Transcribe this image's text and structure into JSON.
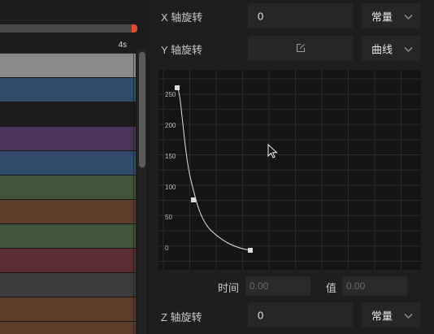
{
  "timeline": {
    "ruler_label": "4s",
    "tracks": [
      {
        "color": "#8a8a8a"
      },
      {
        "color": "#2f4a6a"
      },
      {
        "color": "#1c1c1c"
      },
      {
        "color": "#4a3458"
      },
      {
        "color": "#2f4a6a"
      },
      {
        "color": "#3f5438"
      },
      {
        "color": "#5c3d2c"
      },
      {
        "color": "#3f5438"
      },
      {
        "color": "#5a2e30"
      },
      {
        "color": "#3c3c3c"
      },
      {
        "color": "#5c3d2c"
      },
      {
        "color": "#5c3d2c"
      }
    ]
  },
  "props": {
    "x_rotation": {
      "label": "X 轴旋转",
      "value": "0",
      "mode": "常量"
    },
    "y_rotation": {
      "label": "Y 轴旋转",
      "mode": "曲线",
      "edit_icon": "edit-icon"
    },
    "curve": {
      "y_ticks": [
        "250",
        "200",
        "150",
        "100",
        "50",
        "0"
      ]
    },
    "keyframe": {
      "time_label": "时间",
      "time_placeholder": "0.00",
      "value_label": "值",
      "value_placeholder": "0.00"
    },
    "z_rotation": {
      "label": "Z 轴旋转",
      "value": "0",
      "mode": "常量"
    }
  }
}
